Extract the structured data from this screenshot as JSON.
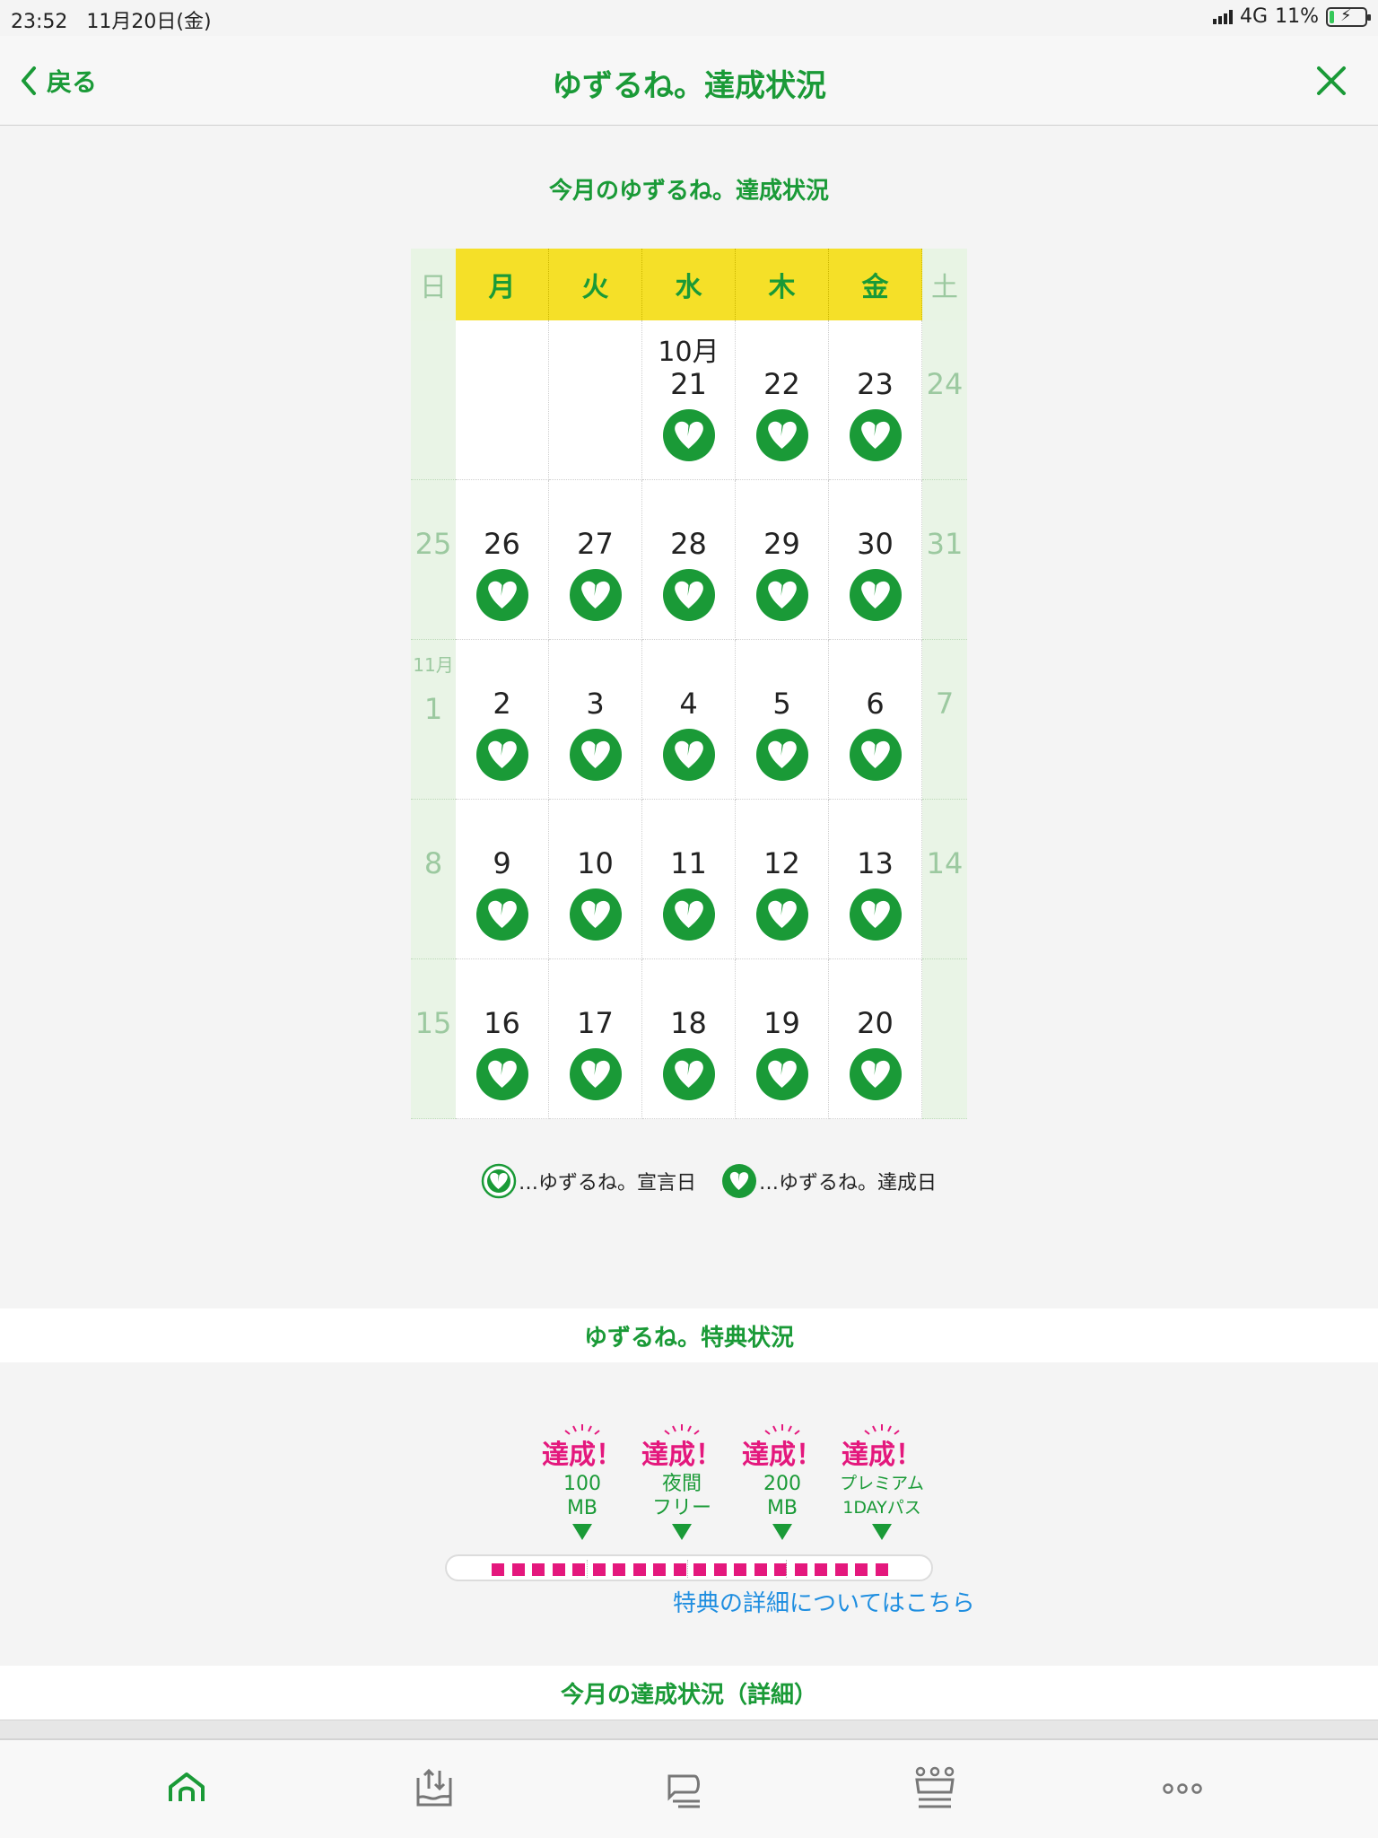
{
  "status_bar": {
    "time": "23:52",
    "date": "11月20日(金)",
    "network": "4G",
    "battery": "11%"
  },
  "nav": {
    "back_label": "戻る",
    "title": "ゆずるね。達成状況"
  },
  "calendar": {
    "section_title": "今月のゆずるね。達成状況",
    "weekday_headers": [
      "日",
      "月",
      "火",
      "水",
      "木",
      "金",
      "土"
    ],
    "weeks": [
      {
        "sun": "",
        "days": [
          {
            "num": "",
            "month": "",
            "mark": false
          },
          {
            "num": "",
            "month": "",
            "mark": false
          },
          {
            "num": "21",
            "month": "10月",
            "mark": true
          },
          {
            "num": "22",
            "month": "",
            "mark": true
          },
          {
            "num": "23",
            "month": "",
            "mark": true
          }
        ],
        "sat": "24"
      },
      {
        "sun": "25",
        "days": [
          {
            "num": "26",
            "month": "",
            "mark": true
          },
          {
            "num": "27",
            "month": "",
            "mark": true
          },
          {
            "num": "28",
            "month": "",
            "mark": true
          },
          {
            "num": "29",
            "month": "",
            "mark": true
          },
          {
            "num": "30",
            "month": "",
            "mark": true
          }
        ],
        "sat": "31"
      },
      {
        "sun": "1",
        "sun_month": "11月",
        "days": [
          {
            "num": "2",
            "month": "",
            "mark": true
          },
          {
            "num": "3",
            "month": "",
            "mark": true
          },
          {
            "num": "4",
            "month": "",
            "mark": true
          },
          {
            "num": "5",
            "month": "",
            "mark": true
          },
          {
            "num": "6",
            "month": "",
            "mark": true
          }
        ],
        "sat": "7"
      },
      {
        "sun": "8",
        "days": [
          {
            "num": "9",
            "month": "",
            "mark": true
          },
          {
            "num": "10",
            "month": "",
            "mark": true
          },
          {
            "num": "11",
            "month": "",
            "mark": true
          },
          {
            "num": "12",
            "month": "",
            "mark": true
          },
          {
            "num": "13",
            "month": "",
            "mark": true
          }
        ],
        "sat": "14"
      },
      {
        "sun": "15",
        "days": [
          {
            "num": "16",
            "month": "",
            "mark": true
          },
          {
            "num": "17",
            "month": "",
            "mark": true
          },
          {
            "num": "18",
            "month": "",
            "mark": true
          },
          {
            "num": "19",
            "month": "",
            "mark": true
          },
          {
            "num": "20",
            "month": "",
            "mark": true
          }
        ],
        "sat": ""
      }
    ],
    "legend": {
      "declared": "…ゆずるね。宣言日",
      "achieved": "…ゆずるね。達成日"
    }
  },
  "rewards": {
    "section_title": "ゆずるね。特典状況",
    "milestones": [
      {
        "label": "達成！",
        "line1": "100",
        "line2": "MB"
      },
      {
        "label": "達成！",
        "line1": "夜間",
        "line2": "フリー"
      },
      {
        "label": "達成！",
        "line1": "200",
        "line2": "MB"
      },
      {
        "label": "達成！",
        "line1": "プレミアム",
        "line2": "1DAYパス"
      }
    ],
    "progress": {
      "filled_segments": 20,
      "total_segments": 20
    },
    "details_link": "特典の詳細についてはこちら"
  },
  "detail_section_title": "今月の達成状況（詳細）",
  "tabbar": {
    "icons": [
      "home-icon",
      "data-share-icon",
      "chat-icon",
      "ranking-icon",
      "more-icon"
    ]
  },
  "colors": {
    "brand_green": "#1a9a37",
    "accent_pink": "#e4187d",
    "header_yellow": "#f5e028",
    "link_blue": "#1f8ee0"
  }
}
